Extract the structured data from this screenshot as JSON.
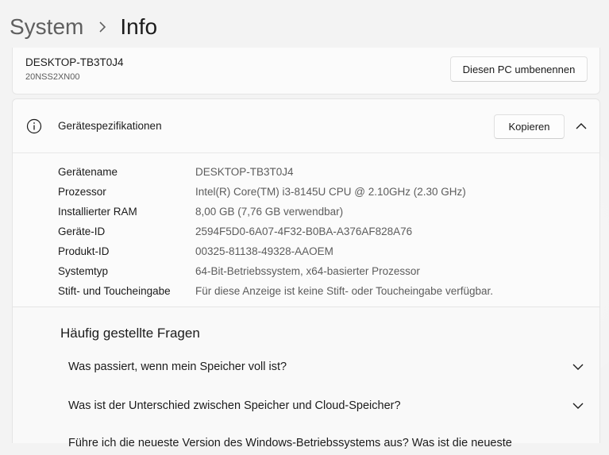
{
  "header": {
    "breadcrumb_parent": "System",
    "breadcrumb_current": "Info"
  },
  "pc_card": {
    "device_name": "DESKTOP-TB3T0J4",
    "model": "20NSS2XN00",
    "rename_button": "Diesen PC umbenennen"
  },
  "specs": {
    "title": "Gerätespezifikationen",
    "copy_button": "Kopieren",
    "rows": [
      {
        "label": "Gerätename",
        "value": "DESKTOP-TB3T0J4"
      },
      {
        "label": "Prozessor",
        "value": "Intel(R) Core(TM) i3-8145U CPU @ 2.10GHz (2.30 GHz)"
      },
      {
        "label": "Installierter RAM",
        "value": "8,00 GB (7,76 GB verwendbar)"
      },
      {
        "label": "Geräte-ID",
        "value": "2594F5D0-6A07-4F32-B0BA-A376AF828A76"
      },
      {
        "label": "Produkt-ID",
        "value": "00325-81138-49328-AAOEM"
      },
      {
        "label": "Systemtyp",
        "value": "64-Bit-Betriebssystem, x64-basierter Prozessor"
      },
      {
        "label": "Stift- und Toucheingabe",
        "value": "Für diese Anzeige ist keine Stift- oder Toucheingabe verfügbar."
      }
    ]
  },
  "faq": {
    "title": "Häufig gestellte Fragen",
    "items": [
      {
        "question": "Was passiert, wenn mein Speicher voll ist?"
      },
      {
        "question": "Was ist der Unterschied zwischen Speicher und Cloud-Speicher?"
      },
      {
        "question": "Führe ich die neueste Version des Windows-Betriebssystems aus? Was ist die neueste"
      }
    ]
  },
  "icons": {
    "breadcrumb_separator": "chevron-right-icon",
    "specs": "info-icon",
    "collapse": "chevron-up-icon",
    "faq_expand": "chevron-down-icon"
  }
}
